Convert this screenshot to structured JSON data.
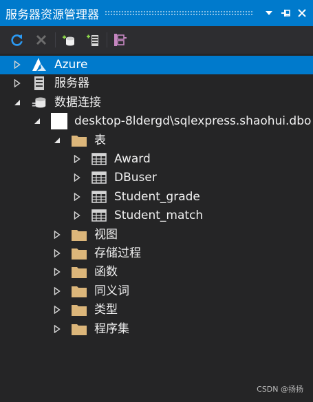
{
  "window": {
    "title": "服务器资源管理器"
  },
  "title_buttons": [
    {
      "name": "dropdown-icon"
    },
    {
      "name": "pin-icon"
    },
    {
      "name": "close-icon"
    }
  ],
  "toolbar": [
    {
      "name": "refresh-icon"
    },
    {
      "name": "stop-icon"
    },
    {
      "name": "connect-database-icon"
    },
    {
      "name": "connect-server-icon"
    },
    {
      "name": "connect-sharepoint-icon"
    }
  ],
  "tree": [
    {
      "label": "Azure",
      "depth": 0,
      "expanded": false,
      "selected": true,
      "icon": "azure-icon"
    },
    {
      "label": "服务器",
      "depth": 0,
      "expanded": false,
      "selected": false,
      "icon": "server-icon"
    },
    {
      "label": "数据连接",
      "depth": 0,
      "expanded": true,
      "selected": false,
      "icon": "data-connections-icon"
    },
    {
      "label": "desktop-8ldergd\\sqlexpress.shaohui.dbo",
      "depth": 1,
      "expanded": true,
      "selected": false,
      "icon": "connection-icon"
    },
    {
      "label": "表",
      "depth": 2,
      "expanded": true,
      "selected": false,
      "icon": "folder-icon"
    },
    {
      "label": "Award",
      "depth": 3,
      "expanded": false,
      "selected": false,
      "icon": "table-icon"
    },
    {
      "label": "DBuser",
      "depth": 3,
      "expanded": false,
      "selected": false,
      "icon": "table-icon"
    },
    {
      "label": "Student_grade",
      "depth": 3,
      "expanded": false,
      "selected": false,
      "icon": "table-icon"
    },
    {
      "label": "Student_match",
      "depth": 3,
      "expanded": false,
      "selected": false,
      "icon": "table-icon"
    },
    {
      "label": "视图",
      "depth": 2,
      "expanded": false,
      "selected": false,
      "icon": "folder-icon"
    },
    {
      "label": "存储过程",
      "depth": 2,
      "expanded": false,
      "selected": false,
      "icon": "folder-icon"
    },
    {
      "label": "函数",
      "depth": 2,
      "expanded": false,
      "selected": false,
      "icon": "folder-icon"
    },
    {
      "label": "同义词",
      "depth": 2,
      "expanded": false,
      "selected": false,
      "icon": "folder-icon"
    },
    {
      "label": "类型",
      "depth": 2,
      "expanded": false,
      "selected": false,
      "icon": "folder-icon"
    },
    {
      "label": "程序集",
      "depth": 2,
      "expanded": false,
      "selected": false,
      "icon": "folder-icon"
    }
  ],
  "watermark": "CSDN @扬扬",
  "colors": {
    "accent": "#007acc",
    "background": "#252526",
    "toolbar": "#2d2d30",
    "folder": "#dcb67a",
    "text": "#f1f1f1"
  }
}
